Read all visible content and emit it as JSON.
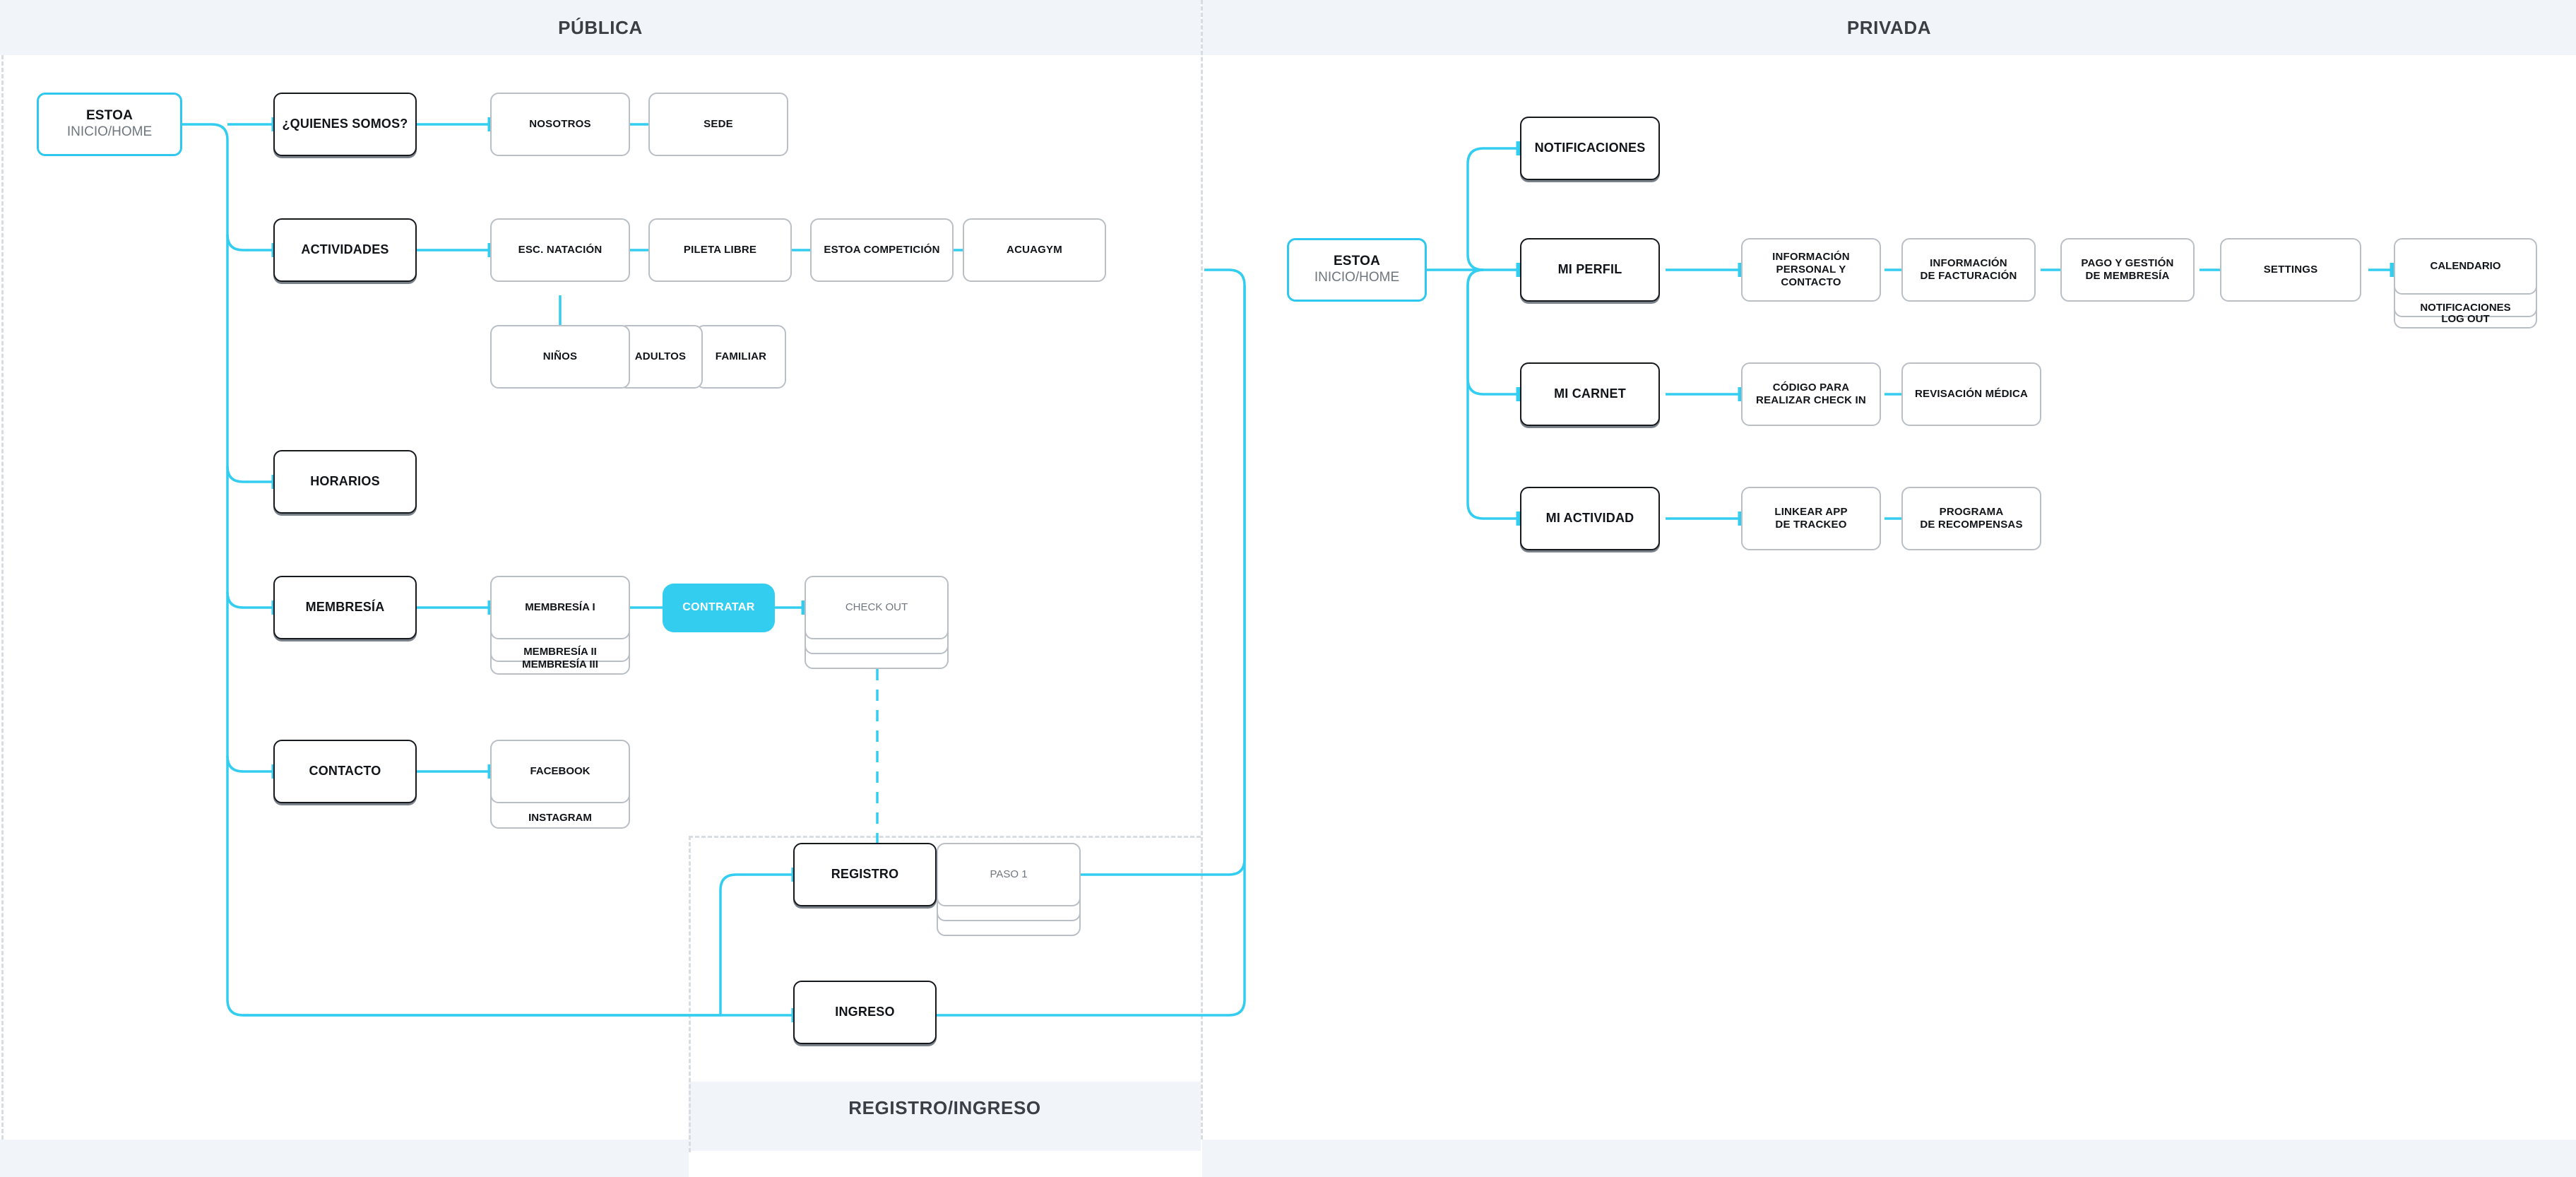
{
  "meta": {
    "accent": "#33cdf0",
    "band_bg": "#f1f4f8",
    "node_border_dark": "#15181c",
    "node_border_light": "#b9bfc5",
    "muted_text": "#6f767d"
  },
  "bands": {
    "publica": "PÚBLICA",
    "privada": "PRIVADA",
    "registro": "REGISTRO/INGRESO"
  },
  "publica": {
    "home": {
      "title": "ESTOA",
      "subtitle": "INICIO/HOME"
    },
    "sections": [
      {
        "label": "¿QUIENES SOMOS?",
        "children": [
          "NOSOTROS",
          "SEDE"
        ]
      },
      {
        "label": "ACTIVIDADES",
        "children": [
          "ESC. NATACIÓN",
          "PILETA LIBRE",
          "ESTOA COMPETICIÓN",
          "ACUAGYM"
        ],
        "sub": [
          "NIÑOS",
          "ADULTOS",
          "FAMILIAR"
        ]
      },
      {
        "label": "HORARIOS",
        "children": []
      },
      {
        "label": "MEMBRESÍA",
        "stack": [
          "MEMBRESÍA I",
          "MEMBRESÍA II",
          "MEMBRESÍA III"
        ],
        "cta": "CONTRATAR",
        "checkout": "CHECK OUT"
      },
      {
        "label": "CONTACTO",
        "stack": [
          "FACEBOOK",
          "INSTAGRAM"
        ]
      }
    ]
  },
  "registro": {
    "registro_label": "REGISTRO",
    "paso_label": "PASO 1",
    "ingreso_label": "INGRESO"
  },
  "privada": {
    "home": {
      "title": "ESTOA",
      "subtitle": "INICIO/HOME"
    },
    "sections": [
      {
        "label": "NOTIFICACIONES",
        "children": []
      },
      {
        "label": "MI PERFIL",
        "children": [
          "INFORMACIÓN\nPERSONAL Y CONTACTO",
          "INFORMACIÓN\nDE FACTURACIÓN",
          "PAGO Y GESTIÓN\nDE MEMBRESÍA",
          "SETTINGS"
        ],
        "stack": [
          "CALENDARIO",
          "NOTIFICACIONES",
          "LOG OUT"
        ]
      },
      {
        "label": "MI CARNET",
        "children": [
          "CÓDIGO PARA\nREALIZAR CHECK IN",
          "REVISACIÓN MÉDICA"
        ]
      },
      {
        "label": "MI ACTIVIDAD",
        "children": [
          "LINKEAR APP\nDE TRACKEO",
          "PROGRAMA\nDE RECOMPENSAS"
        ]
      }
    ]
  }
}
